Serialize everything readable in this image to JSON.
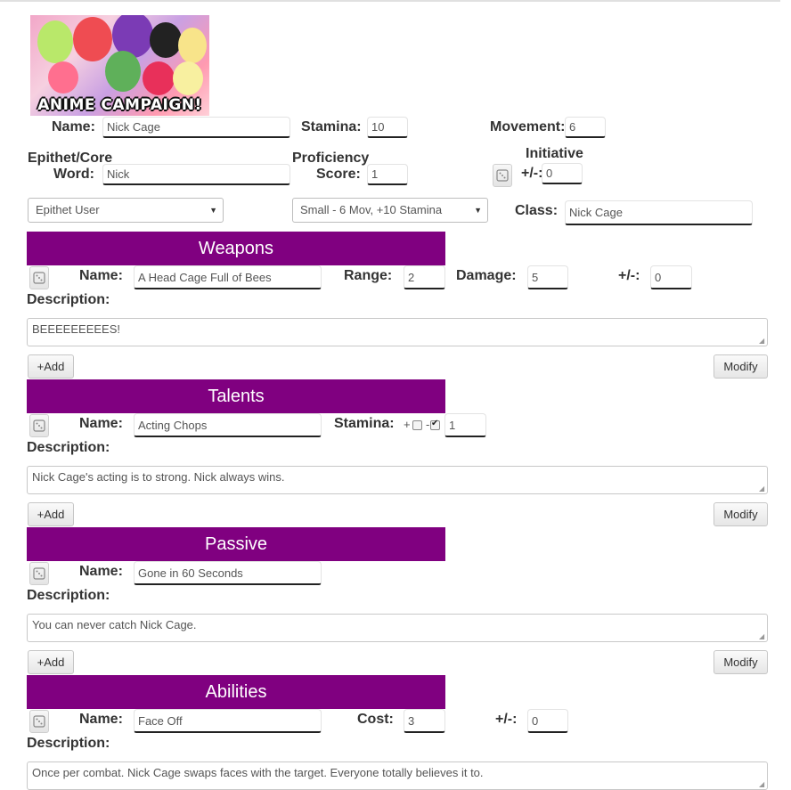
{
  "banner": {
    "text": "ANIME CAMPAIGN!"
  },
  "character": {
    "name_label": "Name:",
    "name_value": "Nick Cage",
    "stamina_label": "Stamina:",
    "stamina_value": "10",
    "movement_label": "Movement:",
    "movement_value": "6",
    "epithet_label_1": "Epithet/Core",
    "epithet_label_2": "Word:",
    "epithet_value": "Nick",
    "proficiency_label_1": "Proficiency",
    "proficiency_label_2": "Score:",
    "proficiency_value": "1",
    "initiative_label": "Initiative",
    "initiative_mod_label": "+/-:",
    "initiative_value": "0",
    "type_select": "Epithet User",
    "size_select": "Small - 6 Mov, +10 Stamina",
    "class_label": "Class:",
    "class_value": "Nick Cage"
  },
  "common": {
    "name_label": "Name:",
    "description_label": "Description:",
    "add_label": "+Add",
    "modify_label": "Modify",
    "mod_label": "+/-:"
  },
  "weapons": {
    "header": "Weapons",
    "name_value": "A Head Cage Full of Bees",
    "range_label": "Range:",
    "range_value": "2",
    "damage_label": "Damage:",
    "damage_value": "5",
    "mod_value": "0",
    "description": "BEEEEEEEEES!"
  },
  "talents": {
    "header": "Talents",
    "name_value": "Acting Chops",
    "stamina_label": "Stamina:",
    "plus_label": "+",
    "minus_label": "-",
    "plus_checked": false,
    "minus_checked": true,
    "stamina_value": "1",
    "description": "Nick Cage's acting is to strong. Nick always wins."
  },
  "passive": {
    "header": "Passive",
    "name_value": "Gone in 60 Seconds",
    "description": "You can never catch Nick Cage."
  },
  "abilities": {
    "header": "Abilities",
    "name_value": "Face Off",
    "cost_label": "Cost:",
    "cost_value": "3",
    "mod_value": "0",
    "description": "Once per combat. Nick Cage swaps faces with the target. Everyone totally believes it to."
  },
  "icons": {
    "dice": "dice-icon",
    "resize": "resize-grip-icon",
    "caret": "caret-down-icon"
  },
  "colors": {
    "section_header": "#800080"
  }
}
